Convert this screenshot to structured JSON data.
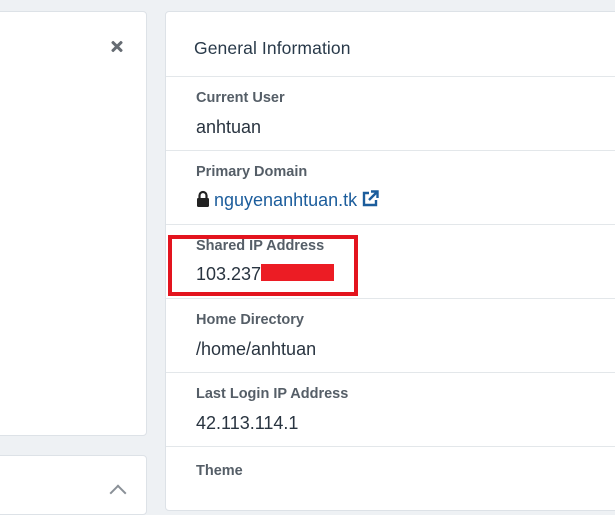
{
  "general_info": {
    "title": "General Information",
    "current_user": {
      "label": "Current User",
      "value": "anhtuan"
    },
    "primary_domain": {
      "label": "Primary Domain",
      "value": "nguyenanhtuan.tk"
    },
    "shared_ip": {
      "label": "Shared IP Address",
      "value": "103.237"
    },
    "home_directory": {
      "label": "Home Directory",
      "value": "/home/anhtuan"
    },
    "last_login_ip": {
      "label": "Last Login IP Address",
      "value": "42.113.114.1"
    },
    "theme": {
      "label": "Theme"
    }
  },
  "colors": {
    "link": "#1c5d9c",
    "highlight": "#e3141e",
    "redaction": "#ec1c24"
  },
  "icons": {
    "close": "close-icon",
    "lock": "lock-icon",
    "external_link": "external-link-icon",
    "chevron": "chevron-up-icon"
  }
}
